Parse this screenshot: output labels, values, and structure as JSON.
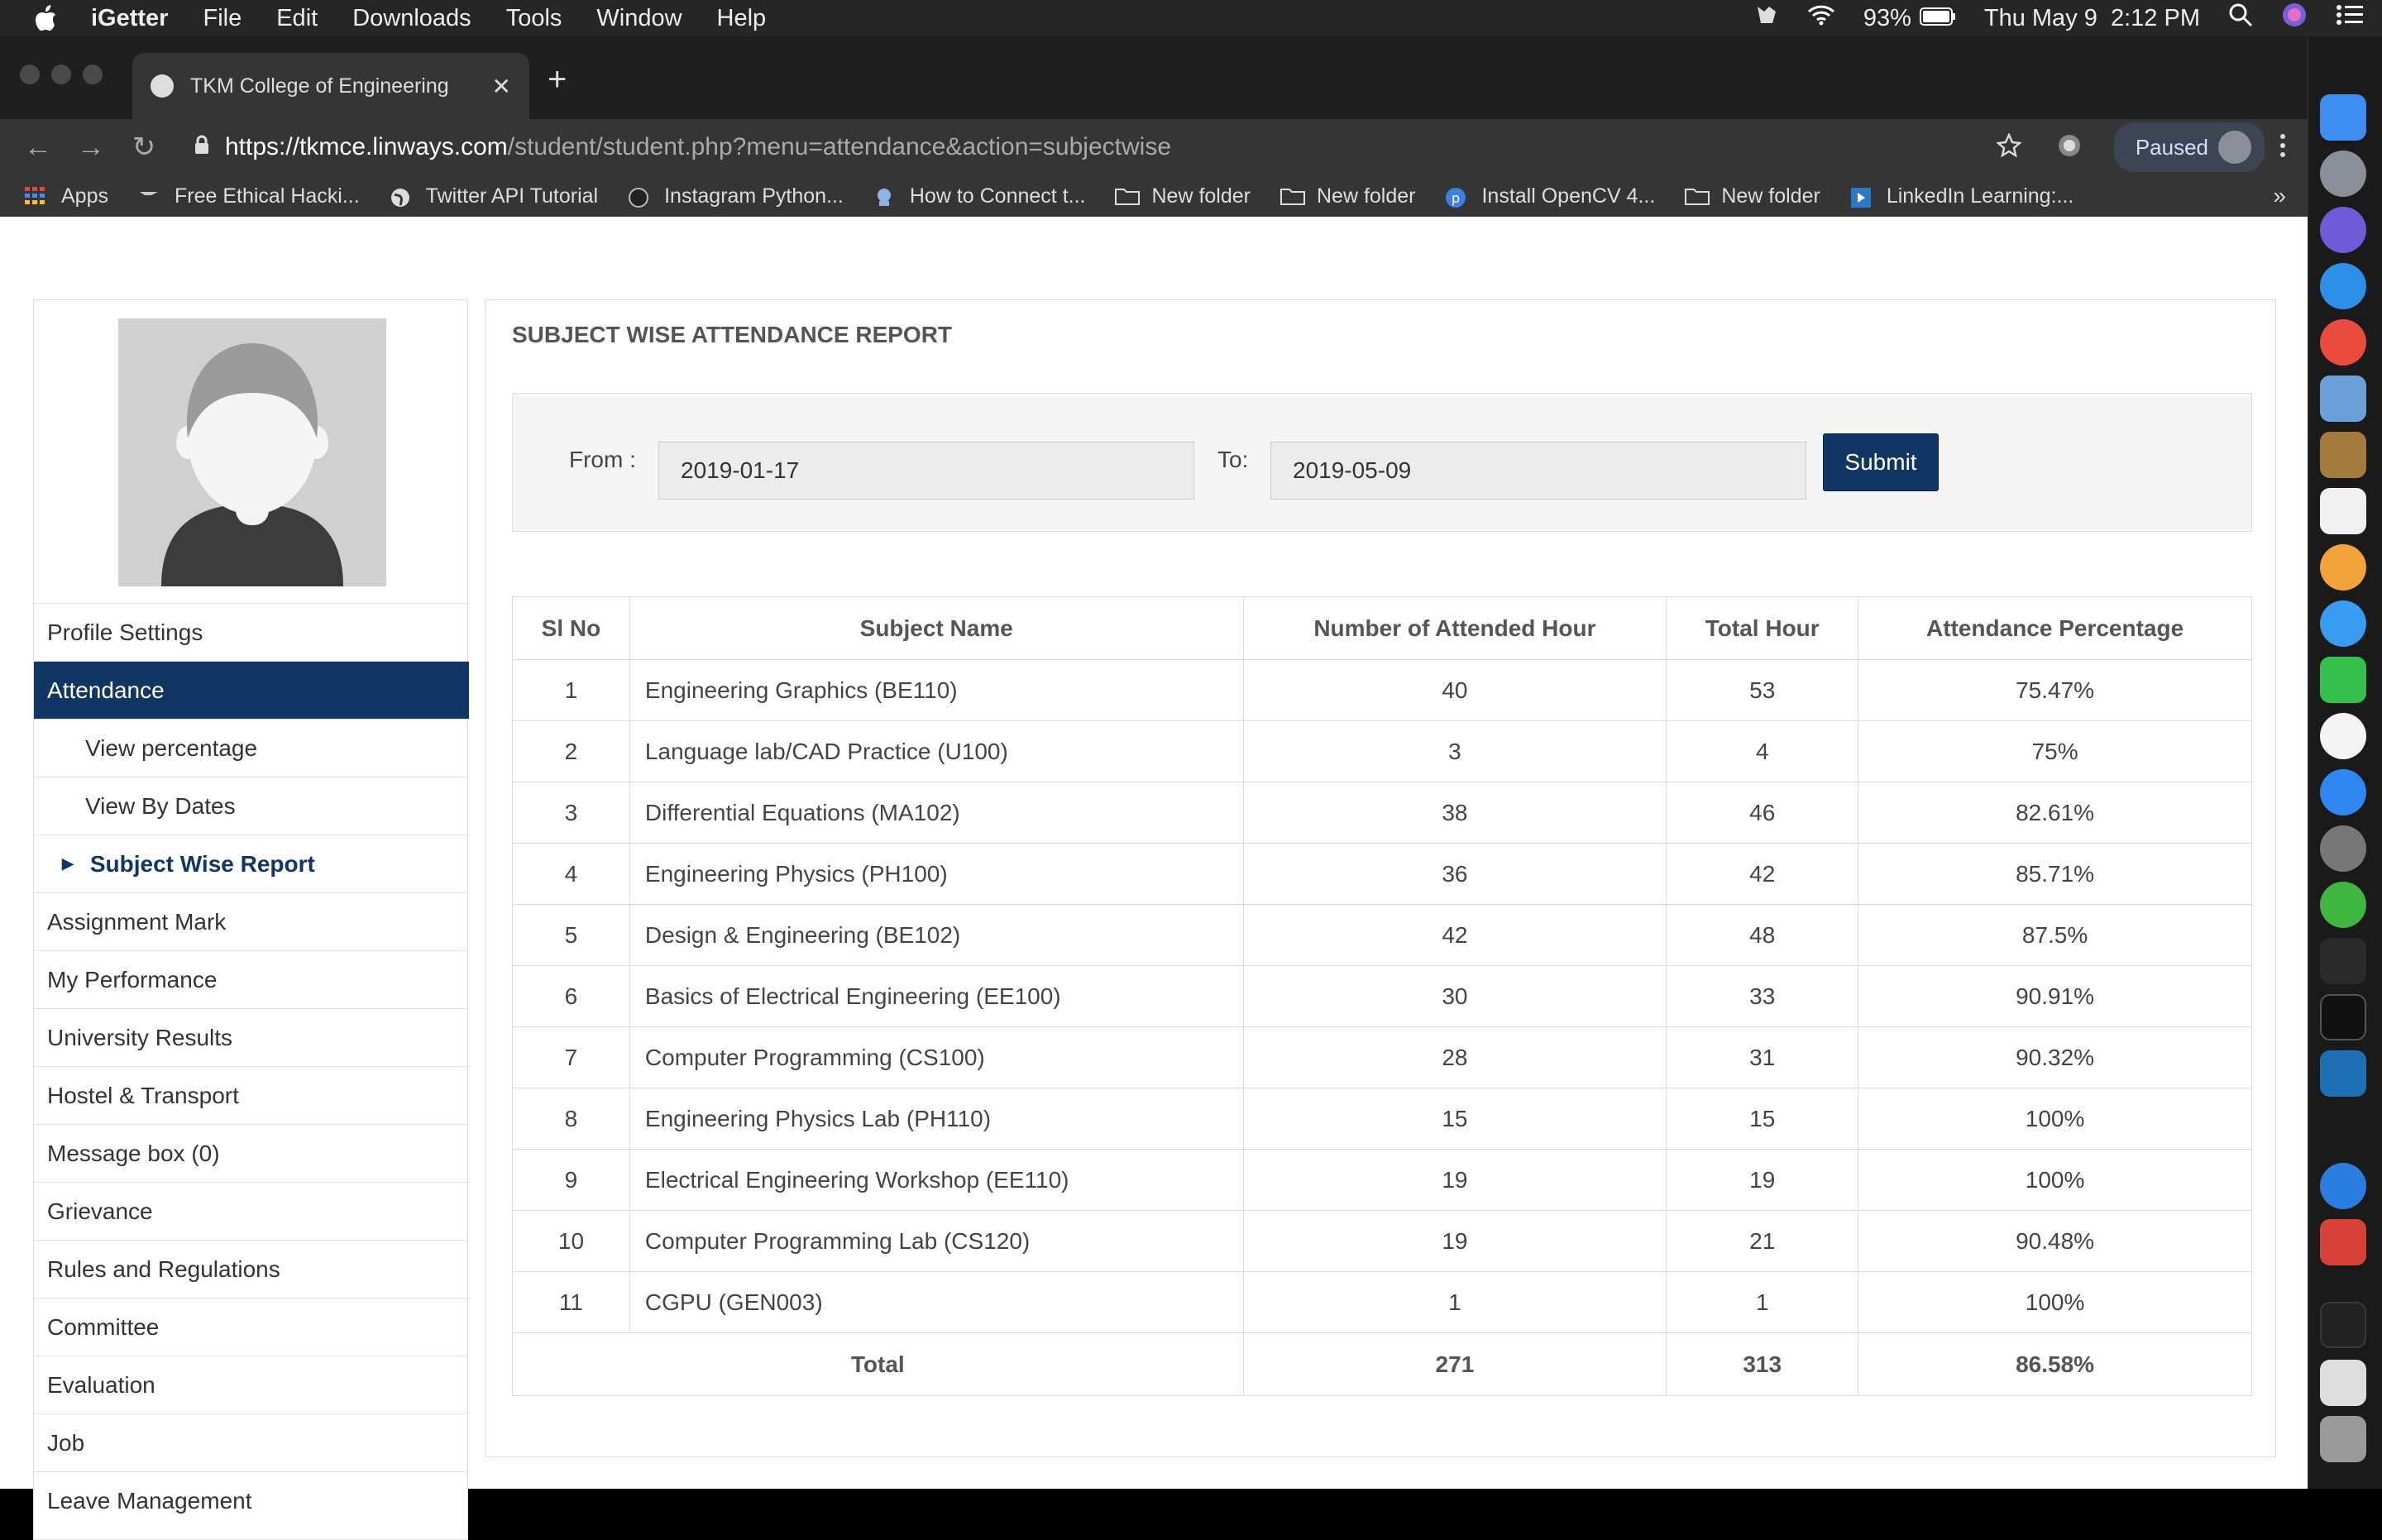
{
  "menubar": {
    "app": "iGetter",
    "menus": [
      "File",
      "Edit",
      "Downloads",
      "Tools",
      "Window",
      "Help"
    ],
    "battery": "93%",
    "clock": "Thu May 9  2:12 PM"
  },
  "browser": {
    "tab_title": "TKM College of Engineering",
    "url_host": "https://tkmce.linways.com",
    "url_rest": "/student/student.php?menu=attendance&action=subjectwise",
    "profile_status": "Paused",
    "bookmarks": [
      {
        "label": "Apps",
        "icon": "apps-grid-icon"
      },
      {
        "label": "Free Ethical Hacki...",
        "icon": "hacker-icon"
      },
      {
        "label": "Twitter API Tutorial",
        "icon": "globe-icon"
      },
      {
        "label": "Instagram Python...",
        "icon": "github-icon"
      },
      {
        "label": "How to Connect t...",
        "icon": "robot-icon"
      },
      {
        "label": "New folder",
        "icon": "folder-icon"
      },
      {
        "label": "New folder",
        "icon": "folder-icon"
      },
      {
        "label": "Install OpenCV 4...",
        "icon": "p-icon"
      },
      {
        "label": "New folder",
        "icon": "folder-icon"
      },
      {
        "label": "LinkedIn Learning:...",
        "icon": "linkedin-learning-icon"
      }
    ]
  },
  "sidebar": {
    "items": [
      {
        "label": "Profile Settings",
        "kind": "normal"
      },
      {
        "label": "Attendance",
        "kind": "active"
      },
      {
        "label": "View percentage",
        "kind": "sub"
      },
      {
        "label": "View By Dates",
        "kind": "sub"
      },
      {
        "label": "Subject Wise Report",
        "kind": "current"
      },
      {
        "label": "Assignment Mark",
        "kind": "normal"
      },
      {
        "label": "My Performance",
        "kind": "normal"
      },
      {
        "label": "University Results",
        "kind": "normal"
      },
      {
        "label": "Hostel & Transport",
        "kind": "normal"
      },
      {
        "label": "Message box (0)",
        "kind": "normal"
      },
      {
        "label": "Grievance",
        "kind": "normal"
      },
      {
        "label": "Rules and Regulations",
        "kind": "normal"
      },
      {
        "label": "Committee",
        "kind": "normal"
      },
      {
        "label": "Evaluation",
        "kind": "normal"
      },
      {
        "label": "Job",
        "kind": "normal"
      },
      {
        "label": "Leave Management",
        "kind": "normal"
      }
    ]
  },
  "report": {
    "title": "SUBJECT WISE ATTENDANCE REPORT",
    "from_label": "From :",
    "from_value": "2019-01-17",
    "to_label": "To:",
    "to_value": "2019-05-09",
    "submit_label": "Submit",
    "columns": [
      "Sl No",
      "Subject Name",
      "Number of Attended Hour",
      "Total Hour",
      "Attendance Percentage"
    ],
    "rows": [
      [
        "1",
        "Engineering Graphics (BE110)",
        "40",
        "53",
        "75.47%"
      ],
      [
        "2",
        "Language lab/CAD Practice (U100)",
        "3",
        "4",
        "75%"
      ],
      [
        "3",
        "Differential Equations (MA102)",
        "38",
        "46",
        "82.61%"
      ],
      [
        "4",
        "Engineering Physics (PH100)",
        "36",
        "42",
        "85.71%"
      ],
      [
        "5",
        "Design & Engineering (BE102)",
        "42",
        "48",
        "87.5%"
      ],
      [
        "6",
        "Basics of Electrical Engineering (EE100)",
        "30",
        "33",
        "90.91%"
      ],
      [
        "7",
        "Computer Programming (CS100)",
        "28",
        "31",
        "90.32%"
      ],
      [
        "8",
        "Engineering Physics Lab (PH110)",
        "15",
        "15",
        "100%"
      ],
      [
        "9",
        "Electrical Engineering Workshop (EE110)",
        "19",
        "19",
        "100%"
      ],
      [
        "10",
        "Computer Programming Lab (CS120)",
        "19",
        "21",
        "90.48%"
      ],
      [
        "11",
        "CGPU (GEN003)",
        "1",
        "1",
        "100%"
      ]
    ],
    "total": {
      "label": "Total",
      "attended": "271",
      "total_hours": "313",
      "percentage": "86.58%"
    }
  },
  "colors": {
    "primary": "#123664",
    "menubar": "#262626",
    "chrome": "#353535"
  }
}
